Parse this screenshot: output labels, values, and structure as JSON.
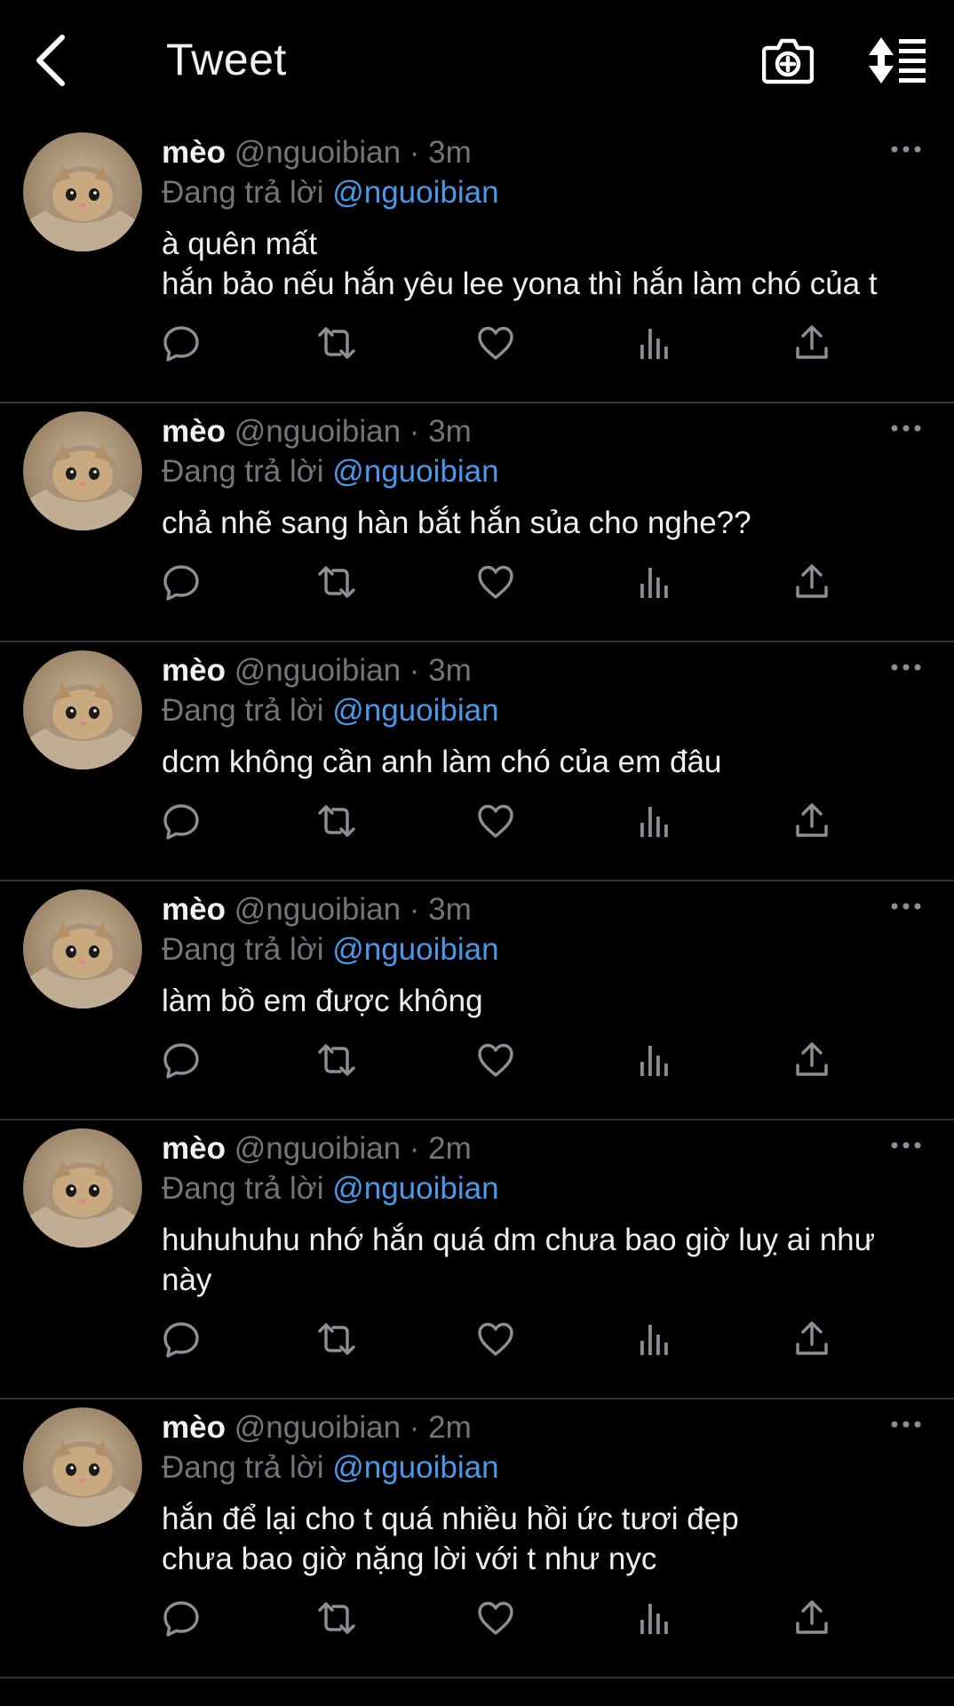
{
  "header": {
    "title": "Tweet",
    "back_icon": "chevron-left-icon",
    "camera_icon": "camera-plus-icon",
    "sort_icon": "sort-icon"
  },
  "colors": {
    "background": "#000000",
    "text": "#e7e9ea",
    "muted": "#71767b",
    "mention": "#4a99e9",
    "divider": "#2f3336"
  },
  "tweets": [
    {
      "name": "mèo",
      "handle": "@nguoibian",
      "time": "3m",
      "reply_prefix": "Đang trả lời",
      "reply_to": "@nguoibian",
      "text": "à quên mất\nhắn bảo nếu hắn yêu lee yona thì hắn làm chó của t"
    },
    {
      "name": "mèo",
      "handle": "@nguoibian",
      "time": "3m",
      "reply_prefix": "Đang trả lời",
      "reply_to": "@nguoibian",
      "text": "chả nhẽ sang hàn bắt hắn sủa cho nghe??"
    },
    {
      "name": "mèo",
      "handle": "@nguoibian",
      "time": "3m",
      "reply_prefix": "Đang trả lời",
      "reply_to": "@nguoibian",
      "text": "dcm không cần anh làm chó của em đâu"
    },
    {
      "name": "mèo",
      "handle": "@nguoibian",
      "time": "3m",
      "reply_prefix": "Đang trả lời",
      "reply_to": "@nguoibian",
      "text": "làm bồ em được không"
    },
    {
      "name": "mèo",
      "handle": "@nguoibian",
      "time": "2m",
      "reply_prefix": "Đang trả lời",
      "reply_to": "@nguoibian",
      "text": "huhuhuhu nhớ hắn quá dm chưa bao giờ luỵ ai như này"
    },
    {
      "name": "mèo",
      "handle": "@nguoibian",
      "time": "2m",
      "reply_prefix": "Đang trả lời",
      "reply_to": "@nguoibian",
      "text": "hắn để lại cho t quá nhiều hồi ức tươi đẹp\nchưa bao giờ nặng lời với t như nyc"
    }
  ],
  "action_icons": [
    "reply-icon",
    "retweet-icon",
    "like-icon",
    "views-icon",
    "share-icon"
  ]
}
